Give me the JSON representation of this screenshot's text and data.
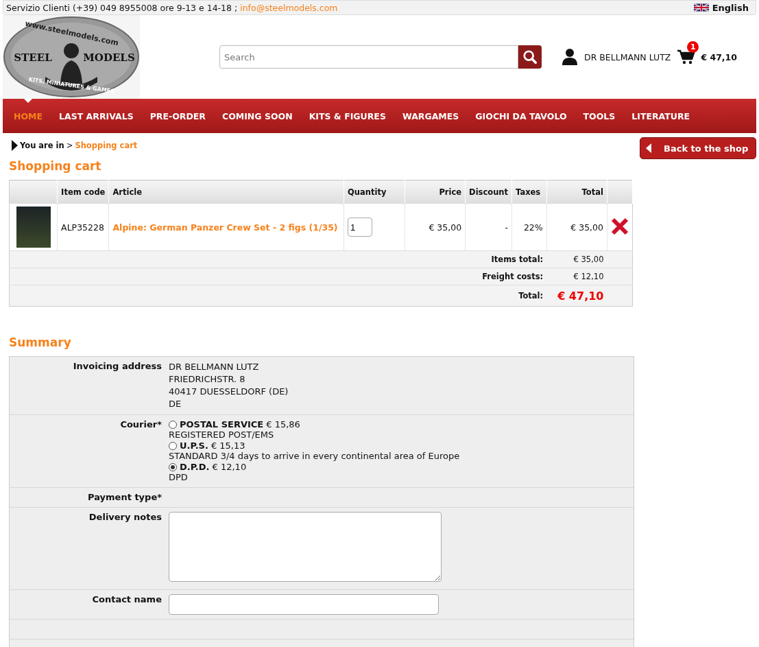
{
  "topbar": {
    "service": "Servizio Clienti (+39) 049 8955008 ore 9-13 e 14-18 ;",
    "email": "info@steelmodels.com",
    "language": "English"
  },
  "logo": {
    "url": "www.steelmodels.com",
    "left": "STEEL",
    "right": "MODELS",
    "tagline": "KITS, MINIATURES & GAMES"
  },
  "search": {
    "placeholder": "Search"
  },
  "user": {
    "name": "DR BELLMANN LUTZ"
  },
  "cart": {
    "count": "1",
    "amount": "€ 47,10"
  },
  "nav": [
    {
      "label": "HOME",
      "selected": true
    },
    {
      "label": "LAST ARRIVALS",
      "selected": false
    },
    {
      "label": "PRE-ORDER",
      "selected": false
    },
    {
      "label": "COMING SOON",
      "selected": false
    },
    {
      "label": "KITS & FIGURES",
      "selected": false
    },
    {
      "label": "WARGAMES",
      "selected": false
    },
    {
      "label": "GIOCHI DA TAVOLO",
      "selected": false
    },
    {
      "label": "TOOLS",
      "selected": false
    },
    {
      "label": "LITERATURE",
      "selected": false
    }
  ],
  "breadcrumb": {
    "prefix": "You are in",
    "separator": ">",
    "current": "Shopping cart"
  },
  "back_button": "Back to the shop",
  "cart_title": "Shopping cart",
  "table": {
    "columns": [
      "Item code",
      "Article",
      "Quantity",
      "Price",
      "Discount",
      "Taxes",
      "Total"
    ],
    "rows": [
      {
        "code": "ALP35228",
        "article": "Alpine: German Panzer Crew Set - 2 figs (1/35)",
        "quantity": "1",
        "price": "€ 35,00",
        "discount": "-",
        "taxes": "22%",
        "total": "€ 35,00"
      }
    ],
    "totals": [
      {
        "label": "Items total:",
        "value": "€ 35,00",
        "kind": "normal"
      },
      {
        "label": "Freight costs:",
        "value": "€ 12,10",
        "kind": "normal"
      },
      {
        "label": "Total:",
        "value": "€ 47,10",
        "kind": "grand"
      }
    ]
  },
  "summary_title": "Summary",
  "summary": [
    {
      "kind": "lines",
      "label": "Invoicing address",
      "lines": [
        "DR BELLMANN LUTZ",
        "FRIEDRICHSTR. 8",
        "40417 DUESSELDORF (DE)",
        "DE"
      ]
    },
    {
      "kind": "radios",
      "label": "Courier*",
      "options": [
        {
          "name": "POSTAL SERVICE",
          "price": "€ 15,86",
          "note": "REGISTERED POST/EMS",
          "selected": false
        },
        {
          "name": "U.P.S.",
          "price": "€ 15,13",
          "note": "STANDARD 3/4 days to arrive in every continental area of Europe",
          "selected": false
        },
        {
          "name": "D.P.D.",
          "price": "€ 12,10",
          "note": "DPD",
          "selected": true
        }
      ]
    },
    {
      "kind": "empty",
      "label": "Payment type*"
    },
    {
      "kind": "textarea",
      "label": "Delivery notes"
    },
    {
      "kind": "input",
      "label": "Contact name"
    },
    {
      "kind": "blank"
    },
    {
      "kind": "blank"
    }
  ]
}
